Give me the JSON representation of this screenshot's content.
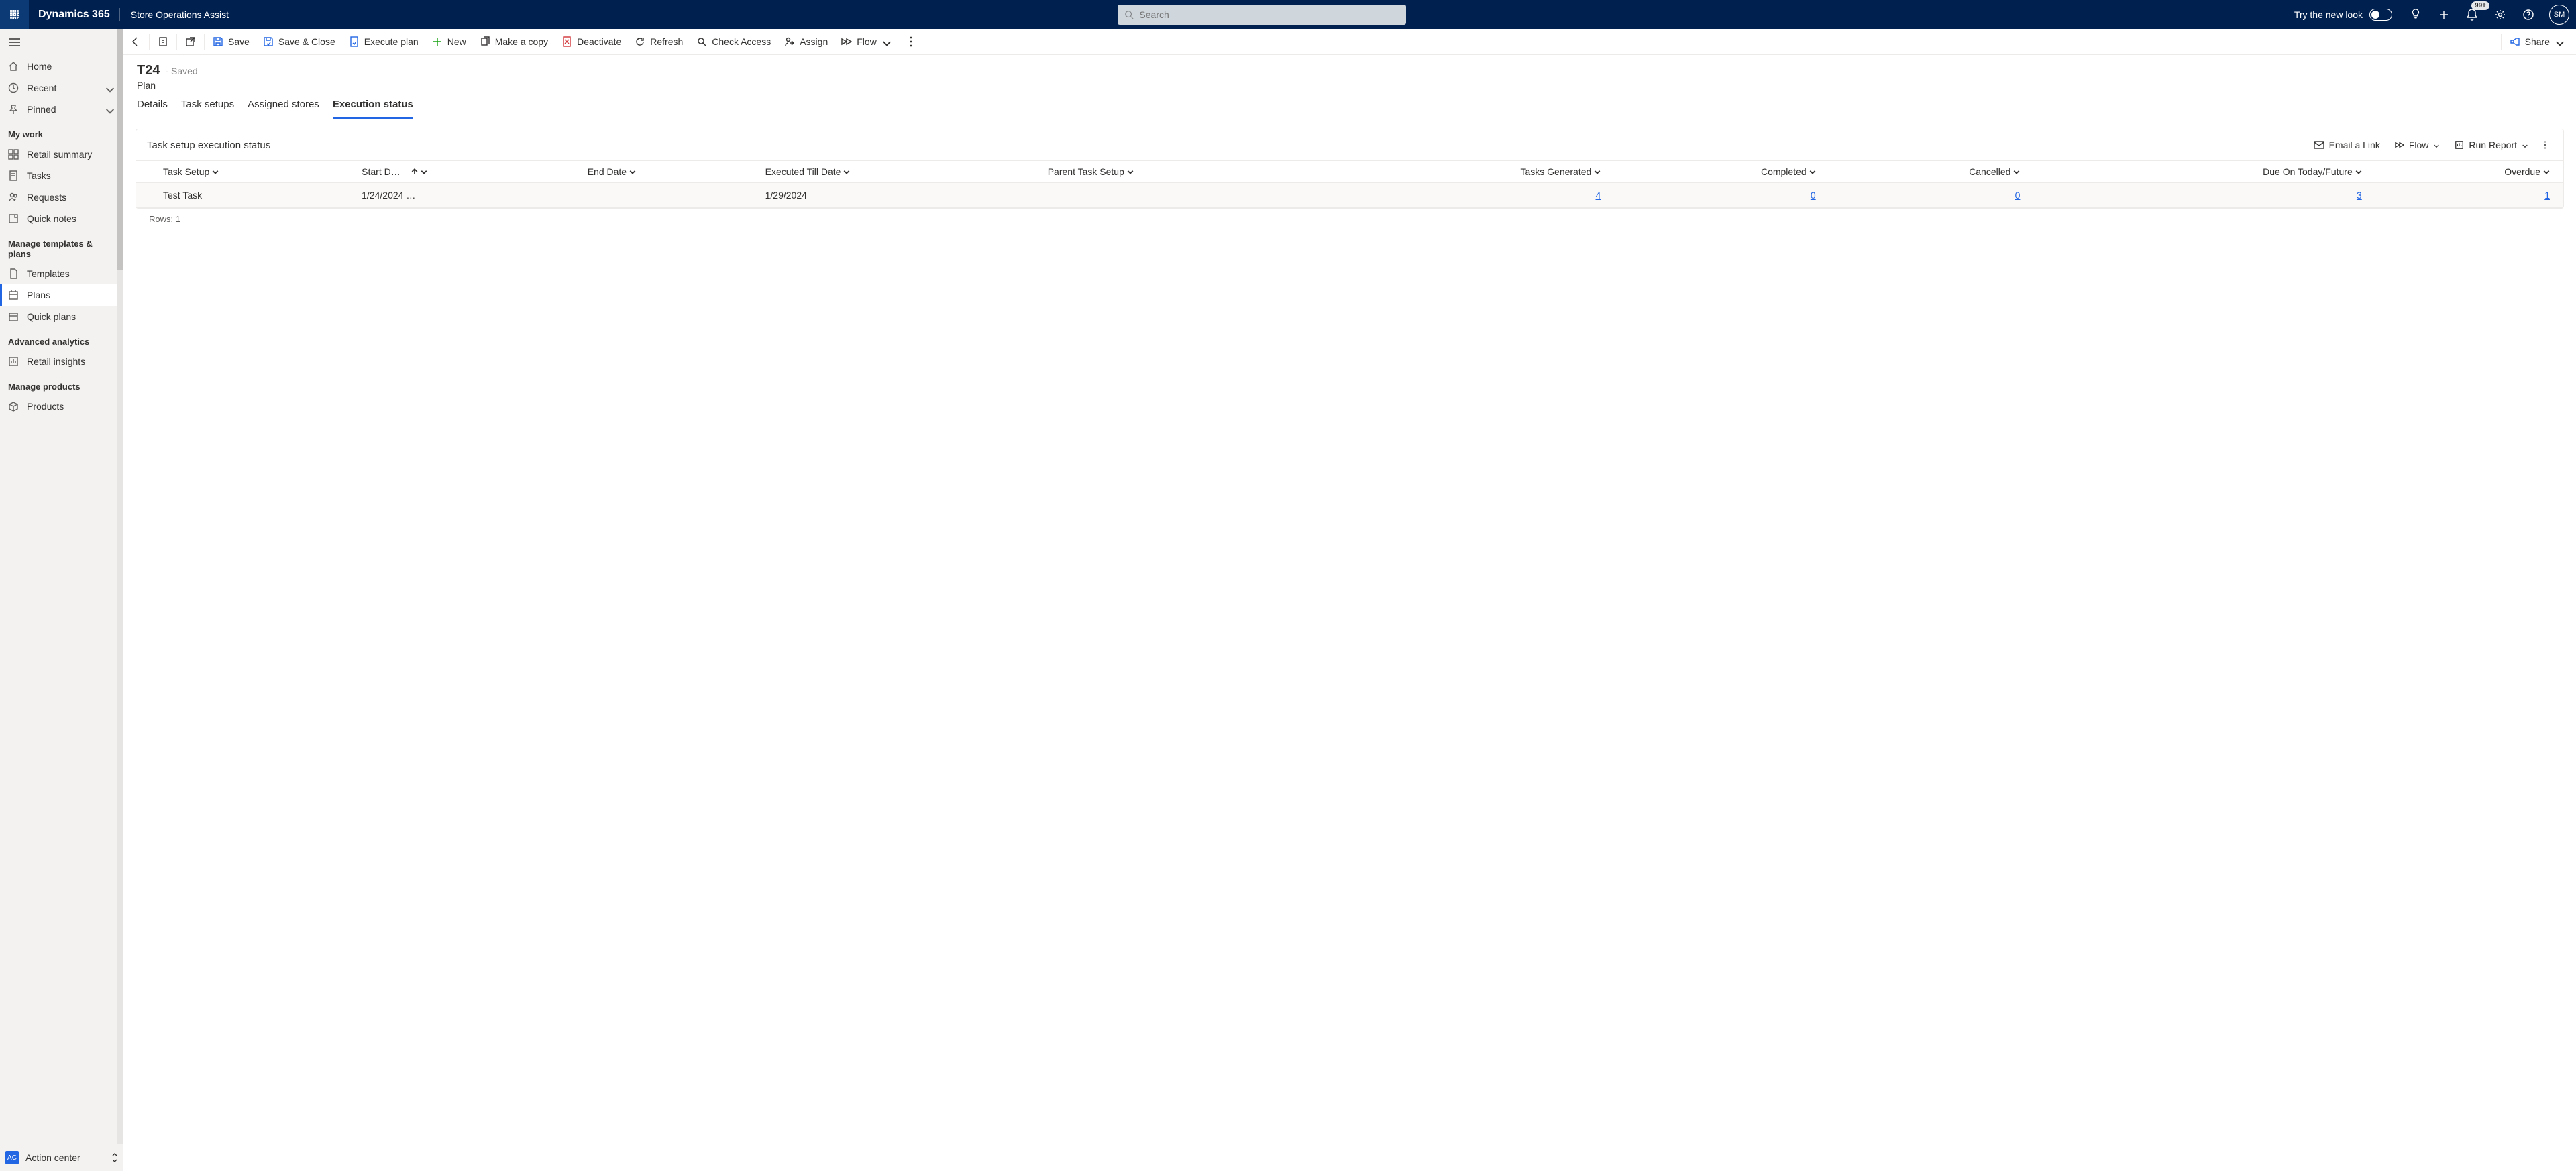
{
  "header": {
    "brand": "Dynamics 365",
    "app": "Store Operations Assist",
    "search_placeholder": "Search",
    "try_new": "Try the new look",
    "notif_badge": "99+",
    "avatar": "SM"
  },
  "sidebar": {
    "home": "Home",
    "recent": "Recent",
    "pinned": "Pinned",
    "group_mywork": "My work",
    "retail_summary": "Retail summary",
    "tasks": "Tasks",
    "requests": "Requests",
    "quick_notes": "Quick notes",
    "group_templates": "Manage templates & plans",
    "templates": "Templates",
    "plans": "Plans",
    "quick_plans": "Quick plans",
    "group_analytics": "Advanced analytics",
    "retail_insights": "Retail insights",
    "group_products": "Manage products",
    "products": "Products",
    "footer_badge": "AC",
    "footer_label": "Action center"
  },
  "commands": {
    "save": "Save",
    "save_close": "Save & Close",
    "execute_plan": "Execute plan",
    "new": "New",
    "make_copy": "Make a copy",
    "deactivate": "Deactivate",
    "refresh": "Refresh",
    "check_access": "Check Access",
    "assign": "Assign",
    "flow": "Flow",
    "share": "Share"
  },
  "record": {
    "title": "T24",
    "state": "- Saved",
    "entity": "Plan"
  },
  "tabs": {
    "details": "Details",
    "task_setups": "Task setups",
    "assigned_stores": "Assigned stores",
    "execution_status": "Execution status"
  },
  "subgrid": {
    "title": "Task setup execution status",
    "email_link": "Email a Link",
    "flow": "Flow",
    "run_report": "Run Report",
    "columns": {
      "task_setup": "Task Setup",
      "start_date": "Start D…",
      "end_date": "End Date",
      "executed_till": "Executed Till Date",
      "parent_task": "Parent Task Setup",
      "tasks_generated": "Tasks Generated",
      "completed": "Completed",
      "cancelled": "Cancelled",
      "due_today_future": "Due On Today/Future",
      "overdue": "Overdue"
    },
    "rows": [
      {
        "task_setup": "Test Task",
        "start_date": "1/24/2024 …",
        "end_date": "",
        "executed_till": "1/29/2024",
        "parent_task": "",
        "tasks_generated": "4",
        "completed": "0",
        "cancelled": "0",
        "due_today_future": "3",
        "overdue": "1"
      }
    ],
    "rows_label": "Rows: 1"
  }
}
